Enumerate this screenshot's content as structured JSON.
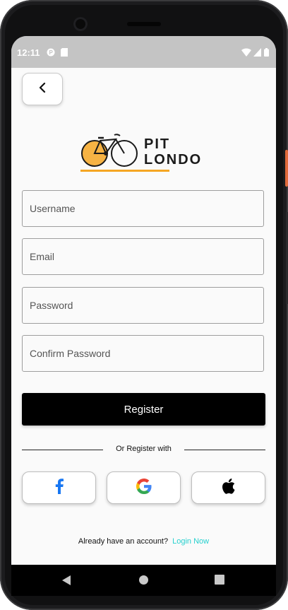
{
  "status_bar": {
    "time": "12:11"
  },
  "logo": {
    "line1": "PIT",
    "line2": "LONDO"
  },
  "form": {
    "username_placeholder": "Username",
    "email_placeholder": "Email",
    "password_placeholder": "Password",
    "confirm_password_placeholder": "Confirm Password",
    "register_label": "Register"
  },
  "divider": {
    "label": "Or Register with"
  },
  "social": [
    {
      "name": "facebook-icon",
      "color": "#1877f2"
    },
    {
      "name": "google-icon",
      "color": "#4285f4"
    },
    {
      "name": "apple-icon",
      "color": "#000000"
    }
  ],
  "footer": {
    "question": "Already have an account?",
    "login_link": "Login Now"
  },
  "colors": {
    "accent": "#26d0ce",
    "logo_orange": "#f5a623",
    "button": "#000000"
  }
}
